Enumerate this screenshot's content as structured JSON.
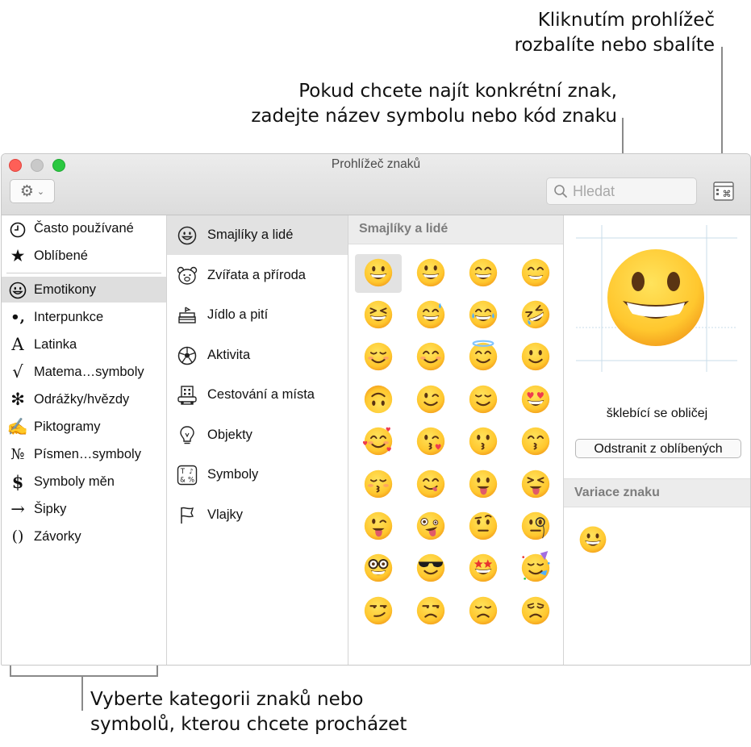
{
  "callouts": {
    "expand": [
      "Kliknutím prohlížeč",
      "rozbalíte nebo sbalíte"
    ],
    "search": [
      "Pokud chcete najít konkrétní znak,",
      "zadejte název symbolu nebo kód znaku"
    ],
    "category": [
      "Vyberte kategorii znaků nebo",
      "symbolů, kterou chcete procházet"
    ]
  },
  "window": {
    "title": "Prohlížeč znaků",
    "search_placeholder": "Hledat"
  },
  "sidebar": {
    "items": [
      {
        "label": "Často používané",
        "icon": "clock-icon",
        "glyph": ""
      },
      {
        "label": "Oblíbené",
        "icon": "star-icon",
        "glyph": "★"
      },
      {
        "label": "Emotikony",
        "icon": "smiley-icon",
        "glyph": "",
        "selected": true
      },
      {
        "label": "Interpunkce",
        "icon": "punctuation-icon",
        "glyph": "•,"
      },
      {
        "label": "Latinka",
        "icon": "latin-letter-icon",
        "glyph": "A"
      },
      {
        "label": "Matema…symboly",
        "icon": "square-root-icon",
        "glyph": "√"
      },
      {
        "label": "Odrážky/hvězdy",
        "icon": "asterisk-icon",
        "glyph": "✻"
      },
      {
        "label": "Piktogramy",
        "icon": "writing-hand-icon",
        "glyph": "✍"
      },
      {
        "label": "Písmen…symboly",
        "icon": "numero-icon",
        "glyph": "№"
      },
      {
        "label": "Symboly měn",
        "icon": "dollar-icon",
        "glyph": "$"
      },
      {
        "label": "Šipky",
        "icon": "arrow-icon",
        "glyph": "→"
      },
      {
        "label": "Závorky",
        "icon": "parentheses-icon",
        "glyph": "()"
      }
    ]
  },
  "subcategories": [
    {
      "label": "Smajlíky a lidé",
      "icon": "smiley-outline-icon",
      "selected": true
    },
    {
      "label": "Zvířata a příroda",
      "icon": "bear-icon"
    },
    {
      "label": "Jídlo a pití",
      "icon": "cake-icon"
    },
    {
      "label": "Aktivita",
      "icon": "soccer-ball-icon"
    },
    {
      "label": "Cestování a místa",
      "icon": "building-icon"
    },
    {
      "label": "Objekty",
      "icon": "lightbulb-icon"
    },
    {
      "label": "Symboly",
      "icon": "symbols-icon"
    },
    {
      "label": "Vlajky",
      "icon": "flag-icon"
    }
  ],
  "grid": {
    "header": "Smajlíky a lidé",
    "emojis": [
      "grinning",
      "smiley",
      "smile",
      "grin",
      "laughing",
      "sweat-smile",
      "joy",
      "rofl",
      "relaxed",
      "blush",
      "innocent",
      "slight-smile",
      "upside-down",
      "wink",
      "relieved",
      "heart-eyes",
      "smiling-hearts",
      "kissing-heart",
      "kissing",
      "kissing-smiling-eyes",
      "kissing-closed-eyes",
      "yum",
      "tongue",
      "squinting-tongue",
      "winking-tongue",
      "zany",
      "raised-eyebrow",
      "monocle",
      "nerd",
      "sunglasses",
      "star-struck",
      "partying",
      "smirk",
      "unamused",
      "disappointed",
      "pensive"
    ]
  },
  "detail": {
    "char_name": "šklebící se obličej",
    "remove_favorite": "Odstranit z oblíbených",
    "variants_header": "Variace znaku",
    "variants": [
      "grinning"
    ]
  },
  "colors": {
    "face": "#ffcc33",
    "face_edge": "#f0a020",
    "selected_bg": "#dedede",
    "close": "#fe5f57",
    "zoom": "#2ac840"
  }
}
